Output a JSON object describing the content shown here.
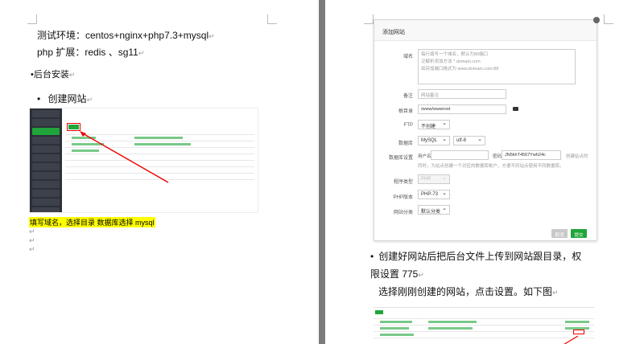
{
  "left": {
    "env_line": "测试环境：centos+nginx+php7.3+mysql",
    "ext_line": "php 扩展：redis 、sg11",
    "install_heading": "后台安装",
    "step1": "创建网站",
    "note_highlight": "填写域名，选择目录 数据库选择 mysql"
  },
  "dialog": {
    "title": "添加网站",
    "domain_label": "域名",
    "domain_placeholder_1": "每行填写一个域名，默认为80端口",
    "domain_placeholder_2": "泛解析添加方法 *.domain.com",
    "domain_placeholder_3": "如另加端口格式为 www.domain.com:88",
    "remark_label": "备注",
    "remark_placeholder": "网站备注",
    "root_label": "根目录",
    "root_value": "/www/wwwroot",
    "ftp_label": "FTP",
    "ftp_value": "不创建",
    "db_label": "数据库",
    "db_value": "MySQL",
    "db_charset": "utf-8",
    "db_setting_label": "数据库设置",
    "db_user_label": "用户名",
    "db_pass_label": "密码",
    "db_pass_value": "JN5khT4567Ywh24c",
    "db_hint_1": "创建站点的",
    "db_hint_2": "同时，为站点创建一个对应的数据库帐户，方便不同站点使用不同数据库。",
    "prog_type_label": "程序类型",
    "prog_type_value": "PHP",
    "php_label": "PHP版本",
    "php_value": "PHP-73",
    "cat_label": "网站分类",
    "cat_value": "默认分类",
    "cancel": "取消",
    "submit": "提交"
  },
  "right": {
    "step2_line1": "创建好网站后把后台文件上传到网站跟目录，权",
    "step2_line2": "限设置 775",
    "select_line": "选择刚刚创建的网站，点击设置。如下图"
  },
  "para_mark": "↵"
}
